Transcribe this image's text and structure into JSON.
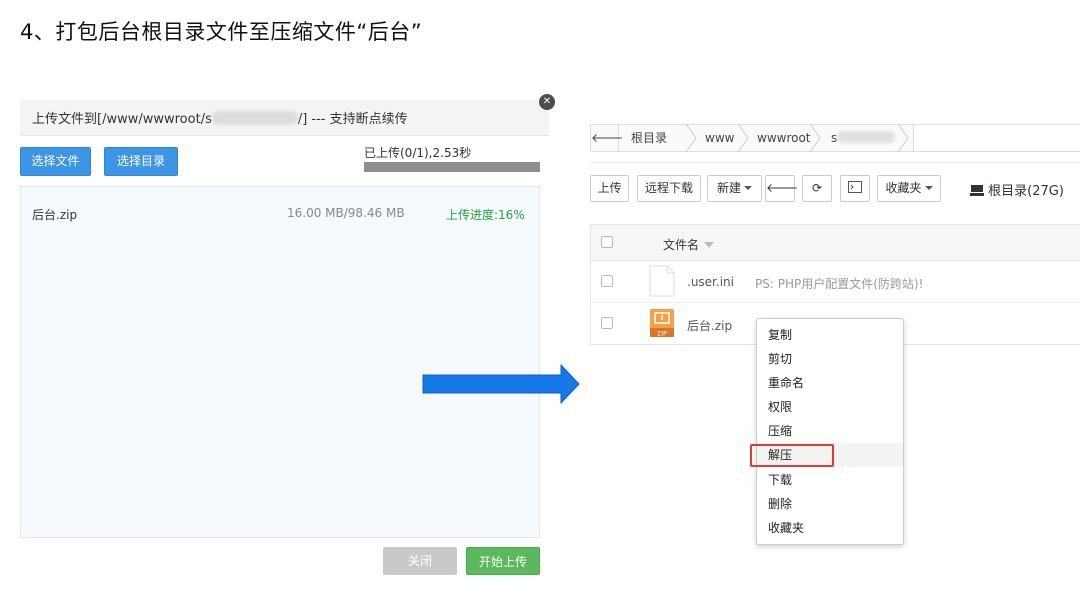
{
  "heading": "4、打包后台根目录文件至压缩文件“后台”",
  "upload_dialog": {
    "title_prefix": "上传文件到[/www/wwwroot/s",
    "title_suffix": "/] --- 支持断点续传",
    "select_file_label": "选择文件",
    "select_dir_label": "选择目录",
    "status": "已上传(0/1),2.53秒",
    "file": {
      "name": "后台.zip",
      "size": "16.00 MB/98.46 MB",
      "progress": "上传进度:16%"
    },
    "close_label": "关闭",
    "start_label": "开始上传"
  },
  "file_manager": {
    "breadcrumb": [
      "根目录",
      "www",
      "wwwroot",
      "s"
    ],
    "toolbar": {
      "upload": "上传",
      "remote_download": "远程下载",
      "new": "新建",
      "favorites": "收藏夹"
    },
    "disk_info": "根目录(27G)",
    "table": {
      "header_name": "文件名",
      "rows": [
        {
          "name": ".user.ini",
          "ps": "PS: PHP用户配置文件(防跨站)!"
        },
        {
          "name": "后台.zip",
          "ps": ""
        }
      ]
    }
  },
  "context_menu": {
    "items": [
      "复制",
      "剪切",
      "重命名",
      "权限",
      "压缩",
      "解压",
      "下载",
      "删除",
      "收藏夹"
    ],
    "highlighted_item": "解压"
  },
  "colors": {
    "accent_blue": "#3d95e6",
    "success_green": "#5cb85c",
    "progress_text_green": "#20a53a",
    "highlight_red": "#e03a3a",
    "arrow_blue": "#1877e6"
  }
}
